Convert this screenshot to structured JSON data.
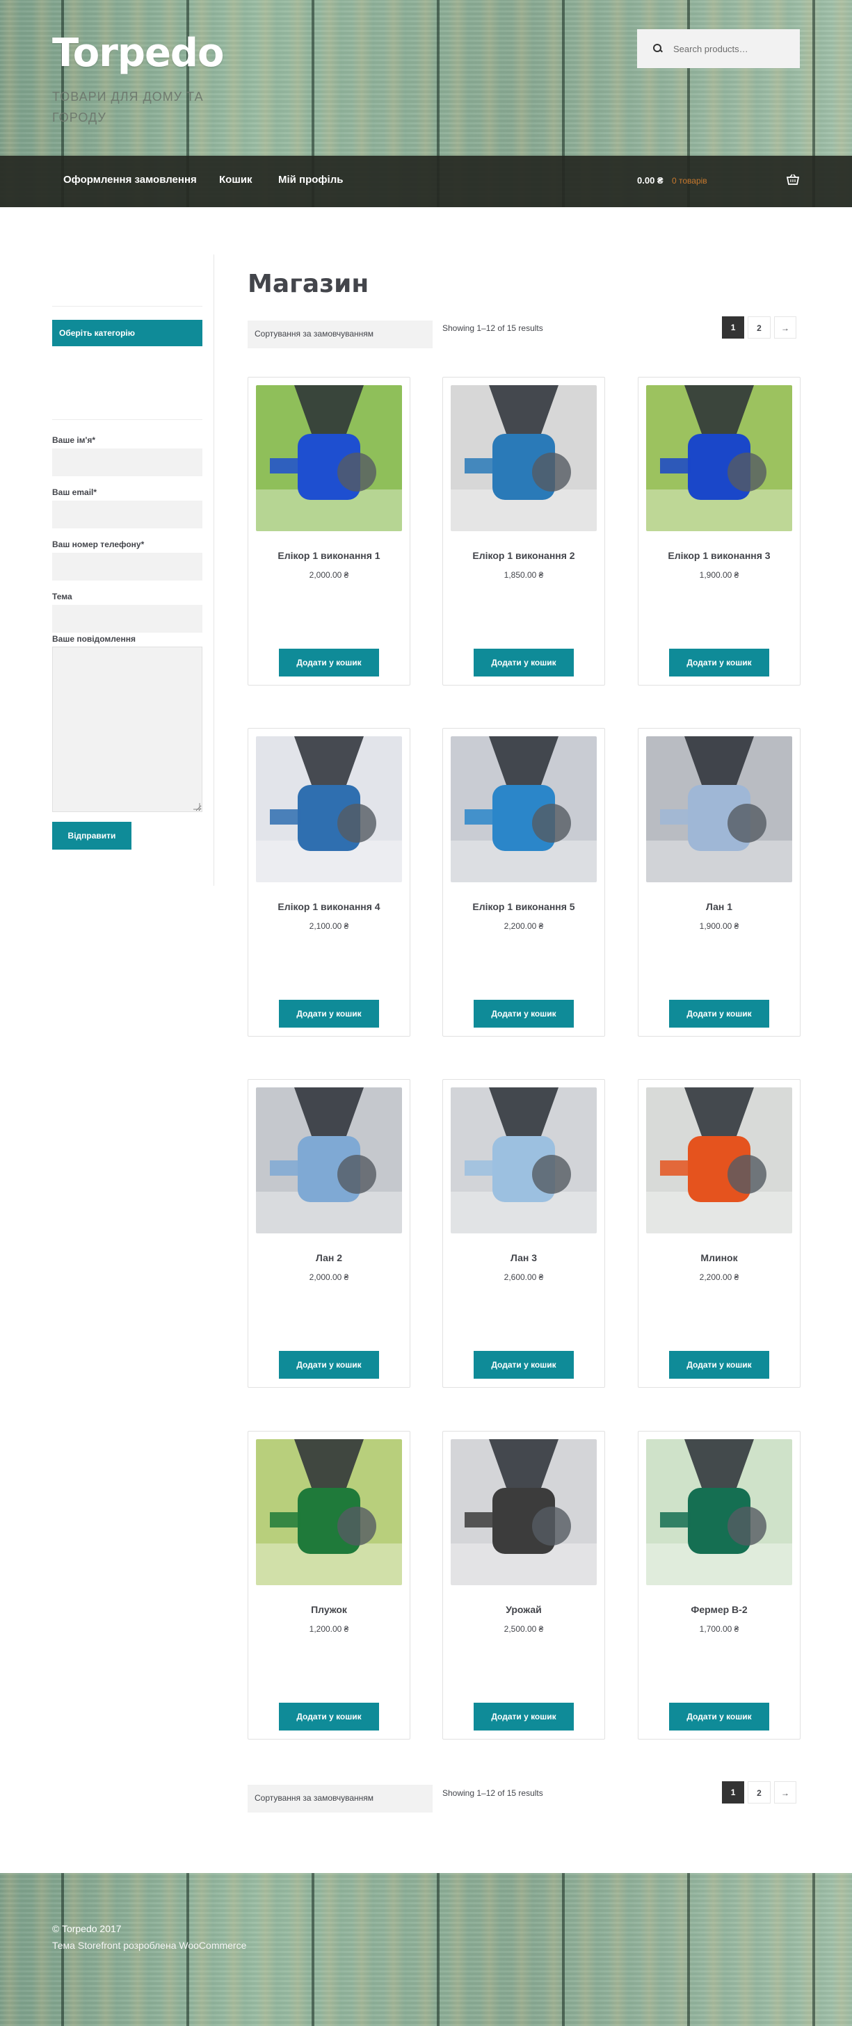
{
  "header": {
    "site_title": "Torpedo",
    "tagline": "ТОВАРИ ДЛЯ ДОМУ ТА ГОРОДУ",
    "search_placeholder": "Search products…"
  },
  "nav": {
    "items": [
      "Оформлення замовлення",
      "Кошик",
      "Мій профіль"
    ],
    "cart_total": "0.00 ₴",
    "cart_count": "0 товарів"
  },
  "sidebar": {
    "category_select": "Оберіть категорію",
    "form": {
      "name_label": "Ваше ім'я*",
      "email_label": "Ваш email*",
      "phone_label": "Ваш номер телефону*",
      "subject_label": "Тема",
      "message_label": "Ваше повідомлення",
      "submit_label": "Відправити"
    }
  },
  "main": {
    "page_title": "Магазин",
    "sort_label": "Сортування за замовчуванням",
    "result_count": "Showing 1–12 of 15 results",
    "pagination": [
      "1",
      "2",
      "→"
    ],
    "add_to_cart_label": "Додати у кошик",
    "products": [
      {
        "name": "Елікор 1 виконання 1",
        "price": "2,000.00 ₴",
        "bg": "#8fbf5a",
        "accent": "#1e4fd0"
      },
      {
        "name": "Елікор 1 виконання 2",
        "price": "1,850.00 ₴",
        "bg": "#d7d7d7",
        "accent": "#2a7ab8"
      },
      {
        "name": "Елікор 1 виконання 3",
        "price": "1,900.00 ₴",
        "bg": "#9cc25f",
        "accent": "#1a47c9"
      },
      {
        "name": "Елікор 1 виконання 4",
        "price": "2,100.00 ₴",
        "bg": "#e2e4ea",
        "accent": "#2f6fb0"
      },
      {
        "name": "Елікор 1 виконання 5",
        "price": "2,200.00 ₴",
        "bg": "#c9ccd3",
        "accent": "#2b86c9"
      },
      {
        "name": "Лан 1",
        "price": "1,900.00 ₴",
        "bg": "#b9bcc2",
        "accent": "#9fb7d6"
      },
      {
        "name": "Лан 2",
        "price": "2,000.00 ₴",
        "bg": "#c5c8cd",
        "accent": "#7fa9d4"
      },
      {
        "name": "Лан 3",
        "price": "2,600.00 ₴",
        "bg": "#d2d4d8",
        "accent": "#9cc0e0"
      },
      {
        "name": "Млинок",
        "price": "2,200.00 ₴",
        "bg": "#d8dad8",
        "accent": "#e5531e"
      },
      {
        "name": "Плужок",
        "price": "1,200.00 ₴",
        "bg": "#b8cf7c",
        "accent": "#1f7a3a"
      },
      {
        "name": "Урожай",
        "price": "2,500.00 ₴",
        "bg": "#d4d5d8",
        "accent": "#3c3c3c"
      },
      {
        "name": "Фермер В-2",
        "price": "1,700.00 ₴",
        "bg": "#cfe2c9",
        "accent": "#156f52"
      }
    ]
  },
  "footer": {
    "copyright": "© Torpedo 2017",
    "credit_prefix": "Тема Storefront розроблена",
    "credit_link": "WooCommerce"
  }
}
